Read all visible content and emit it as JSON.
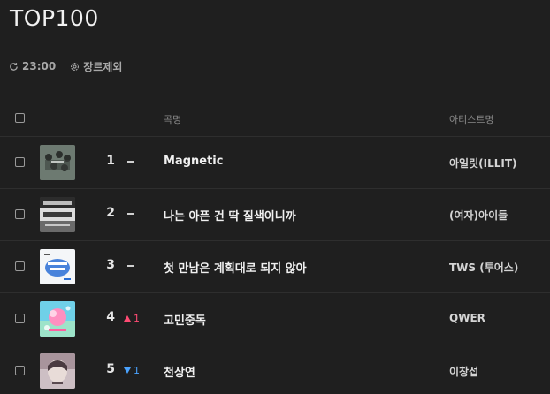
{
  "page": {
    "title": "TOP100"
  },
  "toolbar": {
    "refresh_icon": "refresh-icon",
    "time": "23:00",
    "genre_icon": "settings-gear-icon",
    "genre_exclude_label": "장르제외"
  },
  "table": {
    "headers": {
      "song": "곡명",
      "artist": "아티스트명"
    },
    "rows": [
      {
        "rank": "1",
        "change": "",
        "change_dir": "same",
        "song": "Magnetic",
        "artist": "아일릿(ILLIT)"
      },
      {
        "rank": "2",
        "change": "",
        "change_dir": "same",
        "song": "나는 아픈 건 딱 질색이니까",
        "artist": "(여자)아이들"
      },
      {
        "rank": "3",
        "change": "",
        "change_dir": "same",
        "song": "첫 만남은 계획대로 되지 않아",
        "artist": "TWS (투어스)"
      },
      {
        "rank": "4",
        "change": "1",
        "change_dir": "up",
        "song": "고민중독",
        "artist": "QWER"
      },
      {
        "rank": "5",
        "change": "1",
        "change_dir": "down",
        "song": "천상연",
        "artist": "이창섭"
      }
    ]
  },
  "colors": {
    "background": "#1f1f1f",
    "rank_up": "#ff4b73",
    "rank_down": "#4aa3ff"
  }
}
